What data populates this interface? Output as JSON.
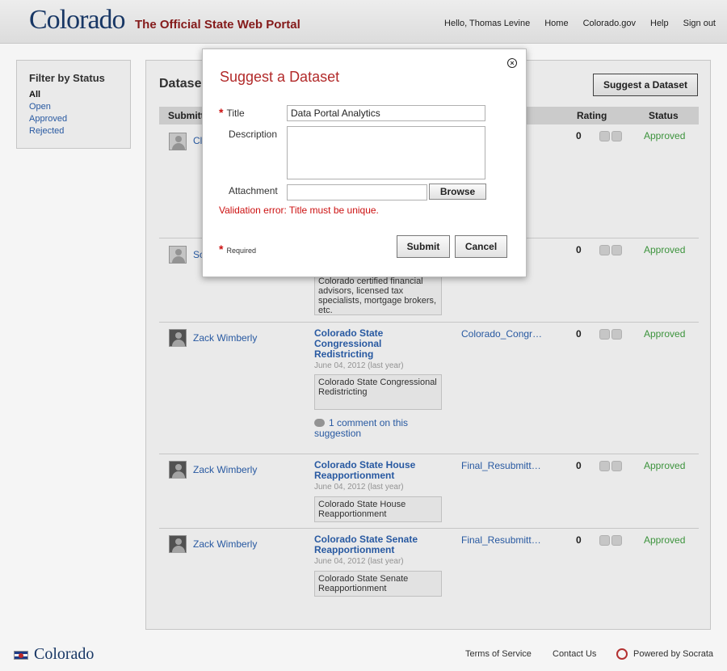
{
  "header": {
    "logo": "Colorado",
    "tagline": "The Official State Web Portal",
    "nav": [
      "Hello, Thomas Levine",
      "Home",
      "Colorado.gov",
      "Help",
      "Sign out"
    ]
  },
  "sidebar": {
    "title": "Filter by Status",
    "items": [
      {
        "label": "All",
        "active": true
      },
      {
        "label": "Open",
        "active": false
      },
      {
        "label": "Approved",
        "active": false
      },
      {
        "label": "Rejected",
        "active": false
      }
    ]
  },
  "main": {
    "title": "Datase",
    "suggest_button": "Suggest a Dataset",
    "columns": {
      "submitter": "Submitt",
      "rating": "Rating",
      "status": "Status"
    },
    "rows": [
      {
        "submitter": "Cl",
        "rating": "0",
        "status": "Approved"
      },
      {
        "submitter": "Sc",
        "description": "Colorado certified financial advisors, licensed tax specialists, mortgage brokers, etc.",
        "rating": "0",
        "status": "Approved"
      },
      {
        "submitter": "Zack Wimberly",
        "title": "Colorado State Congressional Redistricting",
        "date": "June 04, 2012 (last year)",
        "description": "Colorado State Congressional Redistricting",
        "comments": "1 comment on this suggestion",
        "dataset": "Colorado_Congr…",
        "rating": "0",
        "status": "Approved"
      },
      {
        "submitter": "Zack Wimberly",
        "title": "Colorado State House Reapportionment",
        "date": "June 04, 2012 (last year)",
        "description": "Colorado State House Reapportionment",
        "dataset": "Final_Resubmitt…",
        "rating": "0",
        "status": "Approved"
      },
      {
        "submitter": "Zack Wimberly",
        "title": "Colorado State Senate Reapportionment",
        "date": "June 04, 2012 (last year)",
        "description": "Colorado State Senate Reapportionment",
        "dataset": "Final_Resubmitt…",
        "rating": "0",
        "status": "Approved"
      }
    ]
  },
  "modal": {
    "title": "Suggest a Dataset",
    "title_label": "Title",
    "title_value": "Data Portal Analytics",
    "description_label": "Description",
    "description_value": "",
    "attachment_label": "Attachment",
    "attachment_value": "",
    "browse_label": "Browse",
    "error": "Validation error: Title must be unique.",
    "required_note": "Required",
    "submit_label": "Submit",
    "cancel_label": "Cancel",
    "close_glyph": "×"
  },
  "footer": {
    "logo": "Colorado",
    "terms": "Terms of Service",
    "contact": "Contact Us",
    "powered": "Powered by Socrata"
  },
  "colors": {
    "brand_blue": "#1a3a6a",
    "tagline_red": "#8a1c1c",
    "link": "#2a5da8",
    "approved": "#3f9a3f",
    "error": "#cc1111"
  }
}
